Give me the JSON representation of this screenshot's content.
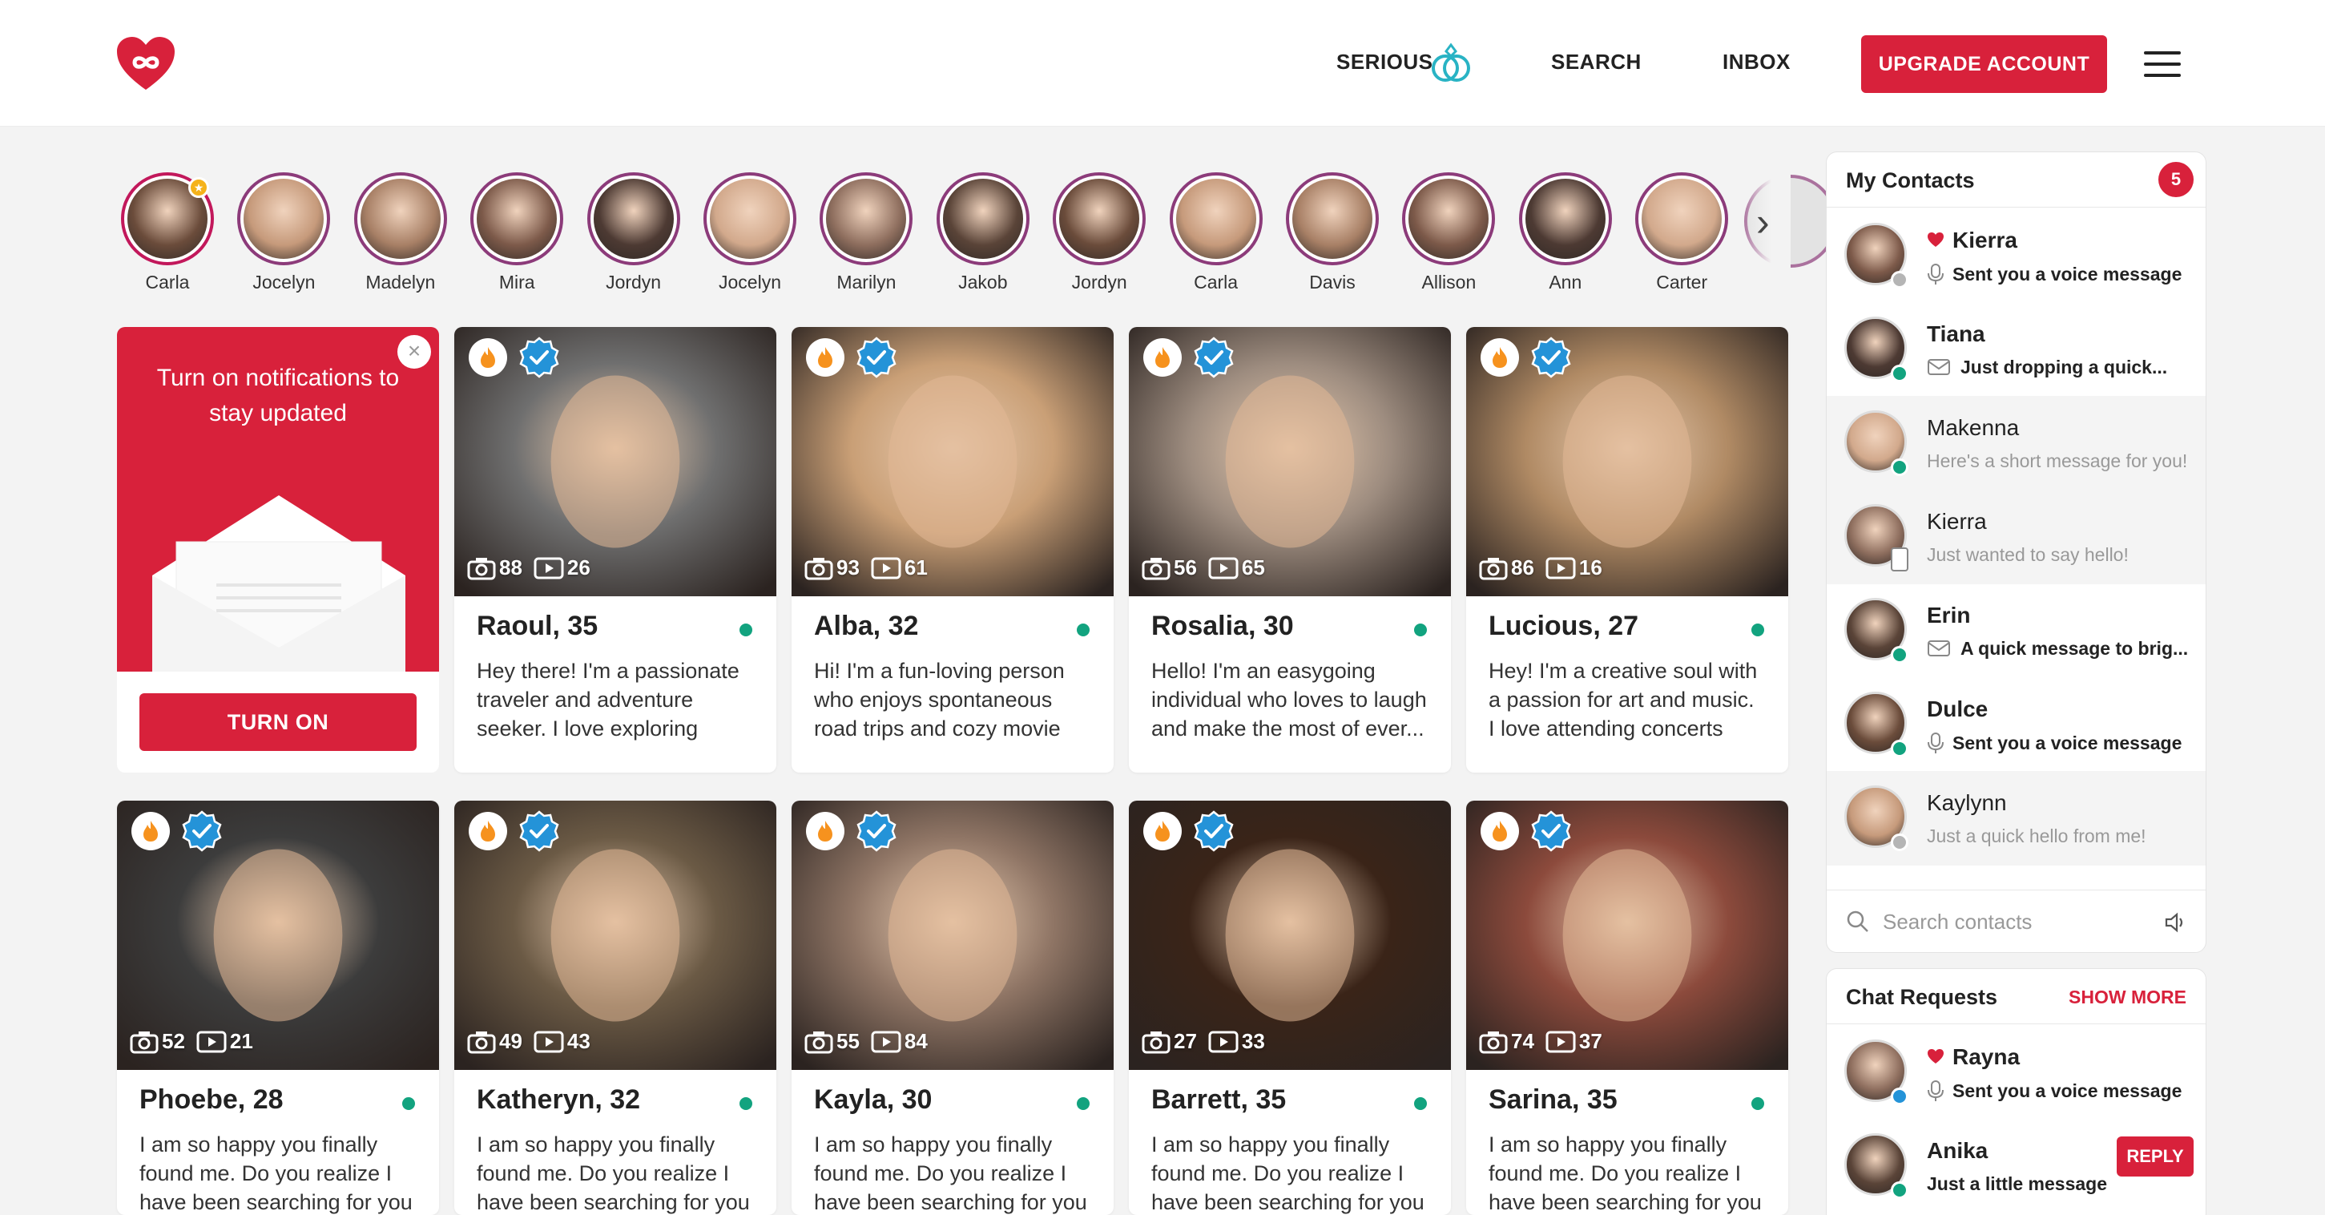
{
  "header": {
    "nav": {
      "serious": "SERIOUS",
      "search": "SEARCH",
      "inbox": "INBOX"
    },
    "upgrade_label": "UPGRADE ACCOUNT",
    "brand_color": "#d8213b"
  },
  "stories": [
    {
      "name": "Carla",
      "starred": true
    },
    {
      "name": "Jocelyn"
    },
    {
      "name": "Madelyn"
    },
    {
      "name": "Mira"
    },
    {
      "name": "Jordyn"
    },
    {
      "name": "Jocelyn"
    },
    {
      "name": "Marilyn"
    },
    {
      "name": "Jakob"
    },
    {
      "name": "Jordyn"
    },
    {
      "name": "Carla"
    },
    {
      "name": "Davis"
    },
    {
      "name": "Allison"
    },
    {
      "name": "Ann"
    },
    {
      "name": "Carter"
    }
  ],
  "notification_card": {
    "text": "Turn on notifications to stay updated",
    "button_label": "TURN ON"
  },
  "profiles_row1": [
    {
      "name": "Raoul, 35",
      "photos": "88",
      "videos": "26",
      "bio": "Hey there! I'm a passionate traveler and adventure seeker. I love exploring new...",
      "tone": "#6f6f6f"
    },
    {
      "name": "Alba, 32",
      "photos": "93",
      "videos": "61",
      "bio": "Hi! I'm a fun-loving person who enjoys spontaneous road trips and cozy movie n...",
      "tone": "#c99f76"
    },
    {
      "name": "Rosalia, 30",
      "photos": "56",
      "videos": "65",
      "bio": "Hello! I'm an easygoing individual who loves to laugh and make the most of ever...",
      "tone": "#9d8c7f"
    },
    {
      "name": "Lucious, 27",
      "photos": "86",
      "videos": "16",
      "bio": "Hey! I'm a creative soul with a passion for art and music. I love attending concerts and...",
      "tone": "#b08a64"
    }
  ],
  "profiles_row2": [
    {
      "name": "Phoebe, 28",
      "photos": "52",
      "videos": "21",
      "bio": "I am so happy you finally found me. Do you realize I have been searching for you",
      "tone": "#3c3c3c"
    },
    {
      "name": "Katheryn, 32",
      "photos": "49",
      "videos": "43",
      "bio": "I am so happy you finally found me. Do you realize I have been searching for you",
      "tone": "#6b5a45"
    },
    {
      "name": "Kayla, 30",
      "photos": "55",
      "videos": "84",
      "bio": "I am so happy you finally found me. Do you realize I have been searching for you",
      "tone": "#8f7565"
    },
    {
      "name": "Barrett, 35",
      "photos": "27",
      "videos": "33",
      "bio": "I am so happy you finally found me. Do you realize I have been searching for you",
      "tone": "#3a2418"
    },
    {
      "name": "Sarina, 35",
      "photos": "74",
      "videos": "37",
      "bio": "I am so happy you finally found me. Do you realize I have been searching for you",
      "tone": "#8c4a3c"
    }
  ],
  "contacts": {
    "title": "My Contacts",
    "count": "5",
    "search_placeholder": "Search contacts",
    "items": [
      {
        "name": "Kierra",
        "message": "Sent you a voice message",
        "unread": true,
        "online": false,
        "icon": "mic-icon",
        "heart": true
      },
      {
        "name": "Tiana",
        "message": "Just dropping a quick...",
        "unread": true,
        "online": true,
        "icon": "message-icon",
        "heart": false
      },
      {
        "name": "Makenna",
        "message": "Here's a short message for you!",
        "unread": false,
        "online": true,
        "icon": "",
        "heart": false
      },
      {
        "name": "Kierra",
        "message": "Just wanted to say hello!",
        "unread": false,
        "online": false,
        "icon": "mobile-icon",
        "heart": false
      },
      {
        "name": "Erin",
        "message": "A quick message to brig...",
        "unread": true,
        "online": true,
        "icon": "message-icon",
        "heart": false
      },
      {
        "name": "Dulce",
        "message": "Sent you a voice message",
        "unread": true,
        "online": true,
        "icon": "mic-icon",
        "heart": false
      },
      {
        "name": "Kaylynn",
        "message": "Just a quick hello from me!",
        "unread": false,
        "online": false,
        "icon": "",
        "heart": false
      }
    ]
  },
  "chat_requests": {
    "title": "Chat Requests",
    "show_more": "SHOW MORE",
    "items": [
      {
        "name": "Rayna",
        "message": "Sent you a voice message",
        "heart": true
      },
      {
        "name": "Anika",
        "message": "Just a little message",
        "reply_label": "REPLY"
      }
    ]
  }
}
